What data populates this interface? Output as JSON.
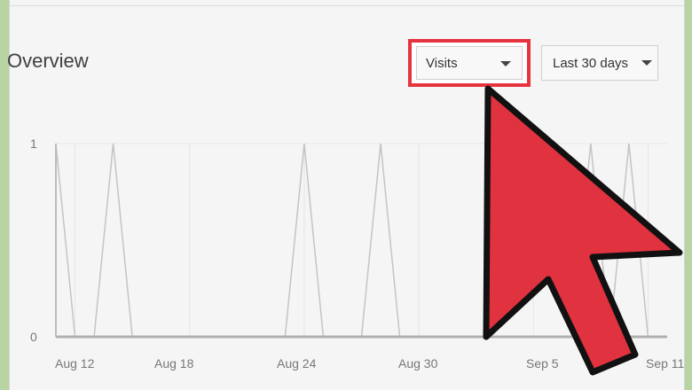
{
  "header": {
    "title": "Overview"
  },
  "controls": {
    "metric": "Visits",
    "range": "Last 30 days",
    "highlight_color": "#e6343f"
  },
  "cursor": {
    "icon": "arrow-cursor-icon",
    "color": "#e0323f"
  },
  "chart_data": {
    "type": "line",
    "title": "",
    "xlabel": "",
    "ylabel": "",
    "ylim": [
      0,
      1
    ],
    "yticks": [
      "1",
      "0"
    ],
    "x_tick_labels": [
      "Aug 12",
      "Aug 18",
      "Aug 24",
      "Aug 30",
      "Sep 5",
      "Sep 11"
    ],
    "x": [
      "Aug 11",
      "Aug 12",
      "Aug 13",
      "Aug 14",
      "Aug 15",
      "Aug 16",
      "Aug 17",
      "Aug 18",
      "Aug 19",
      "Aug 20",
      "Aug 21",
      "Aug 22",
      "Aug 23",
      "Aug 24",
      "Aug 25",
      "Aug 26",
      "Aug 27",
      "Aug 28",
      "Aug 29",
      "Aug 30",
      "Aug 31",
      "Sep 1",
      "Sep 2",
      "Sep 3",
      "Sep 4",
      "Sep 5",
      "Sep 6",
      "Sep 7",
      "Sep 8",
      "Sep 9",
      "Sep 10",
      "Sep 11",
      "Sep 12"
    ],
    "series": [
      {
        "values": [
          1,
          0,
          0,
          1,
          0,
          0,
          0,
          0,
          0,
          0,
          0,
          0,
          0,
          1,
          0,
          0,
          0,
          1,
          0,
          0,
          0,
          0,
          0,
          0,
          0,
          0,
          0,
          0,
          1,
          0,
          1,
          0,
          0
        ]
      }
    ],
    "grid": true
  }
}
